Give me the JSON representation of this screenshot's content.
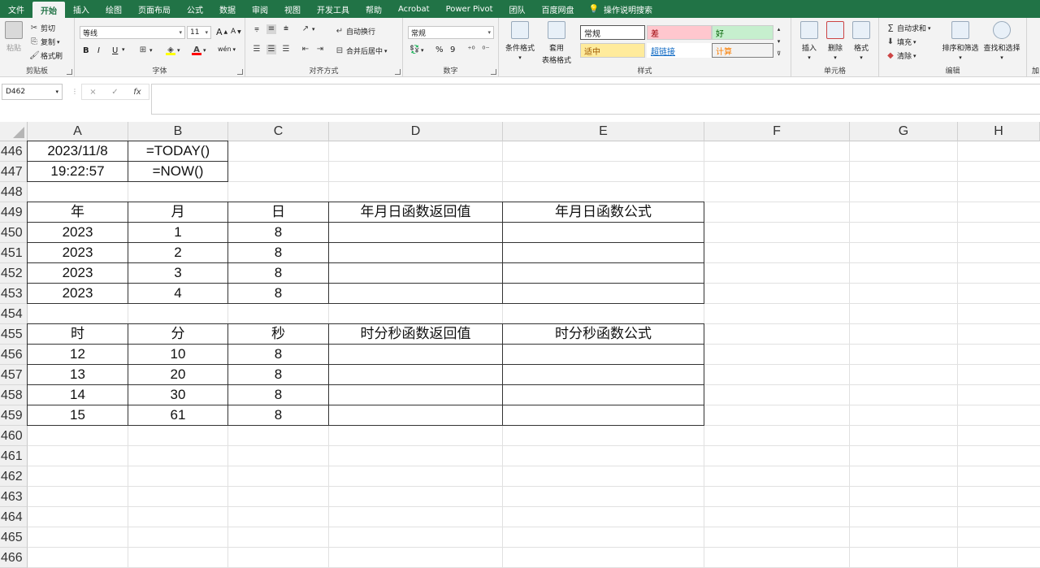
{
  "tabs": [
    "文件",
    "开始",
    "插入",
    "绘图",
    "页面布局",
    "公式",
    "数据",
    "审阅",
    "视图",
    "开发工具",
    "帮助",
    "Acrobat",
    "Power Pivot",
    "团队",
    "百度网盘"
  ],
  "active_tab": 1,
  "search_label": "操作说明搜索",
  "ribbon": {
    "clipboard": {
      "paste": "粘贴",
      "cut": "剪切",
      "copy": "复制",
      "format_painter": "格式刷",
      "label": "剪贴板"
    },
    "font": {
      "name": "等线",
      "size": "11",
      "bold": "B",
      "italic": "I",
      "underline": "U",
      "grow": "A",
      "shrink": "A",
      "color_a": "A",
      "phonetic": "wén",
      "label": "字体"
    },
    "alignment": {
      "wrap": "自动换行",
      "merge": "合并后居中",
      "label": "对齐方式"
    },
    "number": {
      "format": "常规",
      "percent": "%",
      "comma": "9",
      "label": "数字"
    },
    "styles": {
      "cond_format": "条件格式",
      "table_format_1": "套用",
      "table_format_2": "表格格式",
      "normal": "常规",
      "bad": "差",
      "good": "好",
      "neutral": "适中",
      "hyperlink": "超链接",
      "calc": "计算",
      "label": "样式"
    },
    "cells": {
      "insert": "插入",
      "delete": "删除",
      "format": "格式",
      "label": "单元格"
    },
    "editing": {
      "autosum": "自动求和",
      "fill": "填充",
      "clear": "清除",
      "sort": "排序和筛选",
      "find": "查找和选择",
      "label": "编辑"
    },
    "extra": {
      "label": "加"
    }
  },
  "formula_bar": {
    "name_box": "D462",
    "cancel": "×",
    "enter": "✓",
    "fx": "fx"
  },
  "columns": [
    "A",
    "B",
    "C",
    "D",
    "E",
    "F",
    "G",
    "H"
  ],
  "rows": [
    "446",
    "447",
    "448",
    "449",
    "450",
    "451",
    "452",
    "453",
    "454",
    "455",
    "456",
    "457",
    "458",
    "459",
    "460",
    "461",
    "462",
    "463",
    "464",
    "465",
    "466"
  ],
  "cells": {
    "r446": [
      "2023/11/8",
      "=TODAY()"
    ],
    "r447": [
      "19:22:57",
      "=NOW()"
    ],
    "table1_header": [
      "年",
      "月",
      "日",
      "年月日函数返回值",
      "年月日函数公式"
    ],
    "table1_rows": [
      [
        "2023",
        "1",
        "8"
      ],
      [
        "2023",
        "2",
        "8"
      ],
      [
        "2023",
        "3",
        "8"
      ],
      [
        "2023",
        "4",
        "8"
      ]
    ],
    "table2_header": [
      "时",
      "分",
      "秒",
      "时分秒函数返回值",
      "时分秒函数公式"
    ],
    "table2_rows": [
      [
        "12",
        "10",
        "8"
      ],
      [
        "13",
        "20",
        "8"
      ],
      [
        "14",
        "30",
        "8"
      ],
      [
        "15",
        "61",
        "8"
      ]
    ]
  },
  "colors": {
    "ribbon_green": "#217346",
    "bad_fill": "#ffc7ce",
    "good_fill": "#c6efce",
    "neutral_fill": "#ffeb9c",
    "hyperlink": "#0563c1",
    "calc_text": "#fa7d00"
  }
}
